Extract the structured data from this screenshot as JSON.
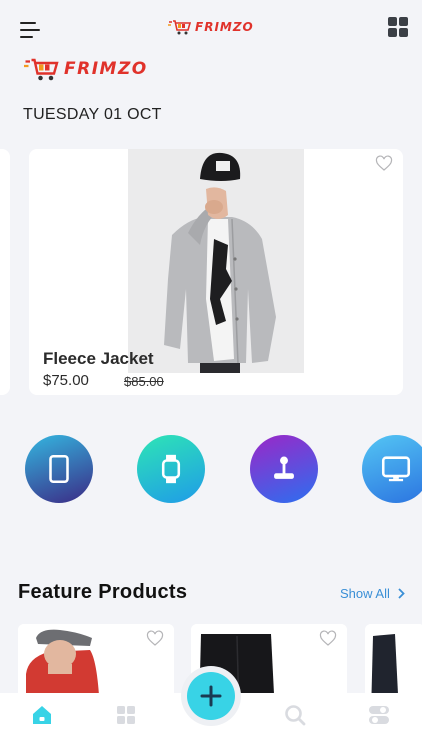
{
  "app": {
    "logo_text": "FRIMZO",
    "brand_color": "#e0322b",
    "menu_icon": "hamburger-menu-icon",
    "grid_icon": "grid-view-icon"
  },
  "header": {
    "date": "TUESDAY 01 OCT"
  },
  "hero": {
    "title": "Fleece Jacket",
    "price": "$75.00",
    "old_price": "$85.00",
    "favorite_icon": "heart-outline-icon"
  },
  "categories": [
    {
      "name": "tablets",
      "icon": "tablet-icon",
      "colors": [
        "#34b7e0",
        "#3b2a85"
      ]
    },
    {
      "name": "smartwatches",
      "icon": "watch-icon",
      "colors": [
        "#2ee5b5",
        "#1f9be8"
      ]
    },
    {
      "name": "gaming",
      "icon": "joystick-icon",
      "colors": [
        "#9b27c7",
        "#2c6ff0"
      ]
    },
    {
      "name": "displays",
      "icon": "monitor-icon",
      "colors": [
        "#54c6f4",
        "#2b73e0"
      ]
    }
  ],
  "featured": {
    "title": "Feature Products",
    "show_all": "Show All"
  },
  "tabbar": {
    "accent": "#38d3e6",
    "items": [
      "home-icon",
      "categories-icon",
      "add-icon",
      "search-icon",
      "settings-toggle-icon"
    ]
  }
}
